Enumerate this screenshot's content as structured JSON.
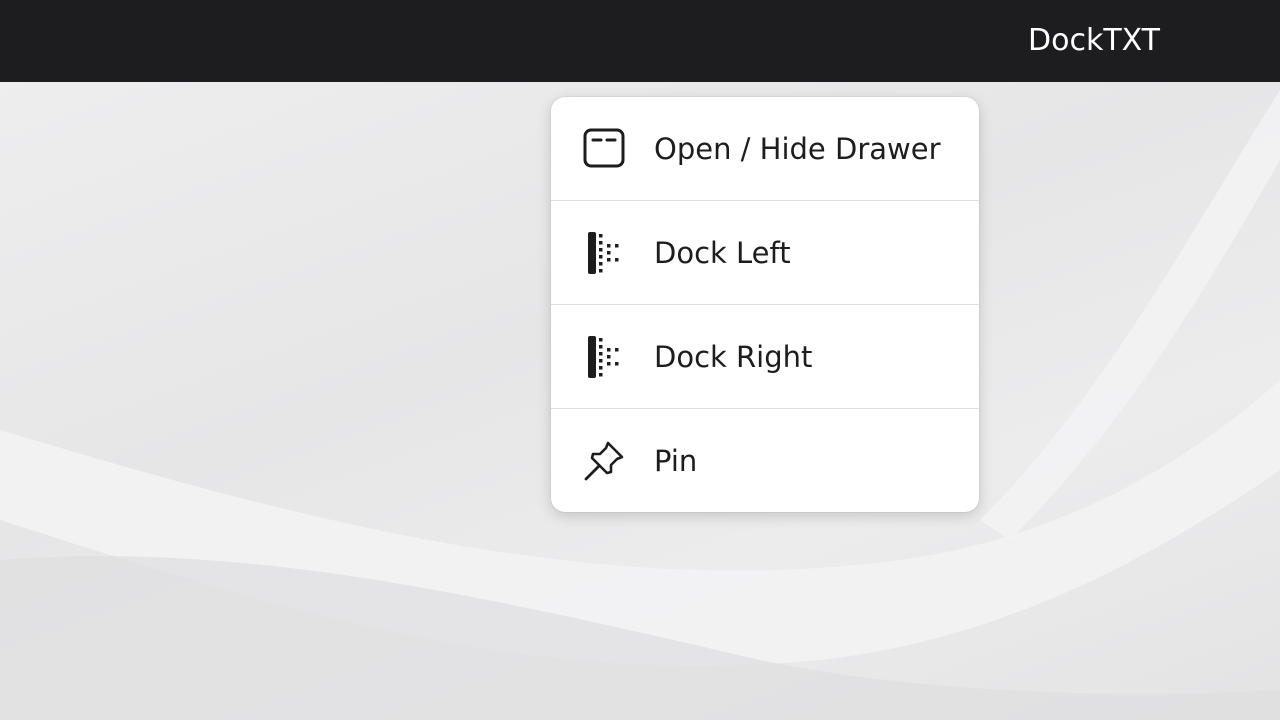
{
  "app": {
    "title": "DockTXT"
  },
  "menu": {
    "items": [
      {
        "label": "Open / Hide Drawer",
        "icon": "window-drawer-icon"
      },
      {
        "label": "Dock Left",
        "icon": "dock-left-icon"
      },
      {
        "label": "Dock Right",
        "icon": "dock-right-icon"
      },
      {
        "label": "Pin",
        "icon": "pin-icon"
      }
    ]
  },
  "colors": {
    "menubar": "#1d1d1f",
    "menu_background": "#ffffff",
    "text": "#1d1d1f",
    "desktop": "#e9e9ea"
  }
}
